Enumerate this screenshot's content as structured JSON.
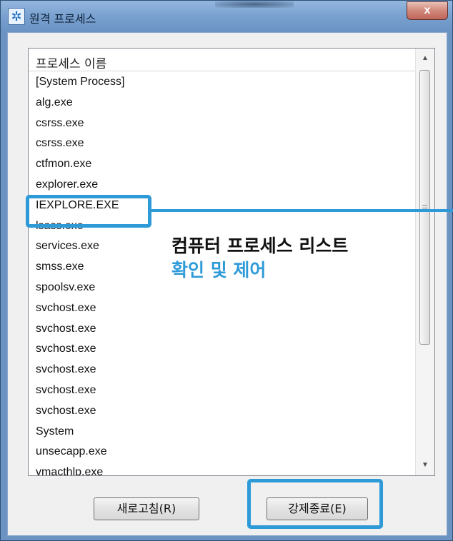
{
  "window": {
    "title": "원격 프로세스",
    "close_label": "x"
  },
  "process_list": {
    "column_header": "프로세스 이름",
    "items": [
      "[System Process]",
      "alg.exe",
      "csrss.exe",
      "csrss.exe",
      "ctfmon.exe",
      "explorer.exe",
      "IEXPLORE.EXE",
      "lsass.exe",
      "services.exe",
      "smss.exe",
      "spoolsv.exe",
      "svchost.exe",
      "svchost.exe",
      "svchost.exe",
      "svchost.exe",
      "svchost.exe",
      "svchost.exe",
      "System",
      "unsecapp.exe",
      "vmacthlp.exe"
    ]
  },
  "buttons": {
    "refresh_label": "새로고침(R)",
    "kill_label": "강제종료(E)"
  },
  "annotation": {
    "line1": "컴퓨터 프로세스 리스트",
    "line2": "확인 및 제어"
  },
  "colors": {
    "highlight": "#2e9ad8"
  }
}
